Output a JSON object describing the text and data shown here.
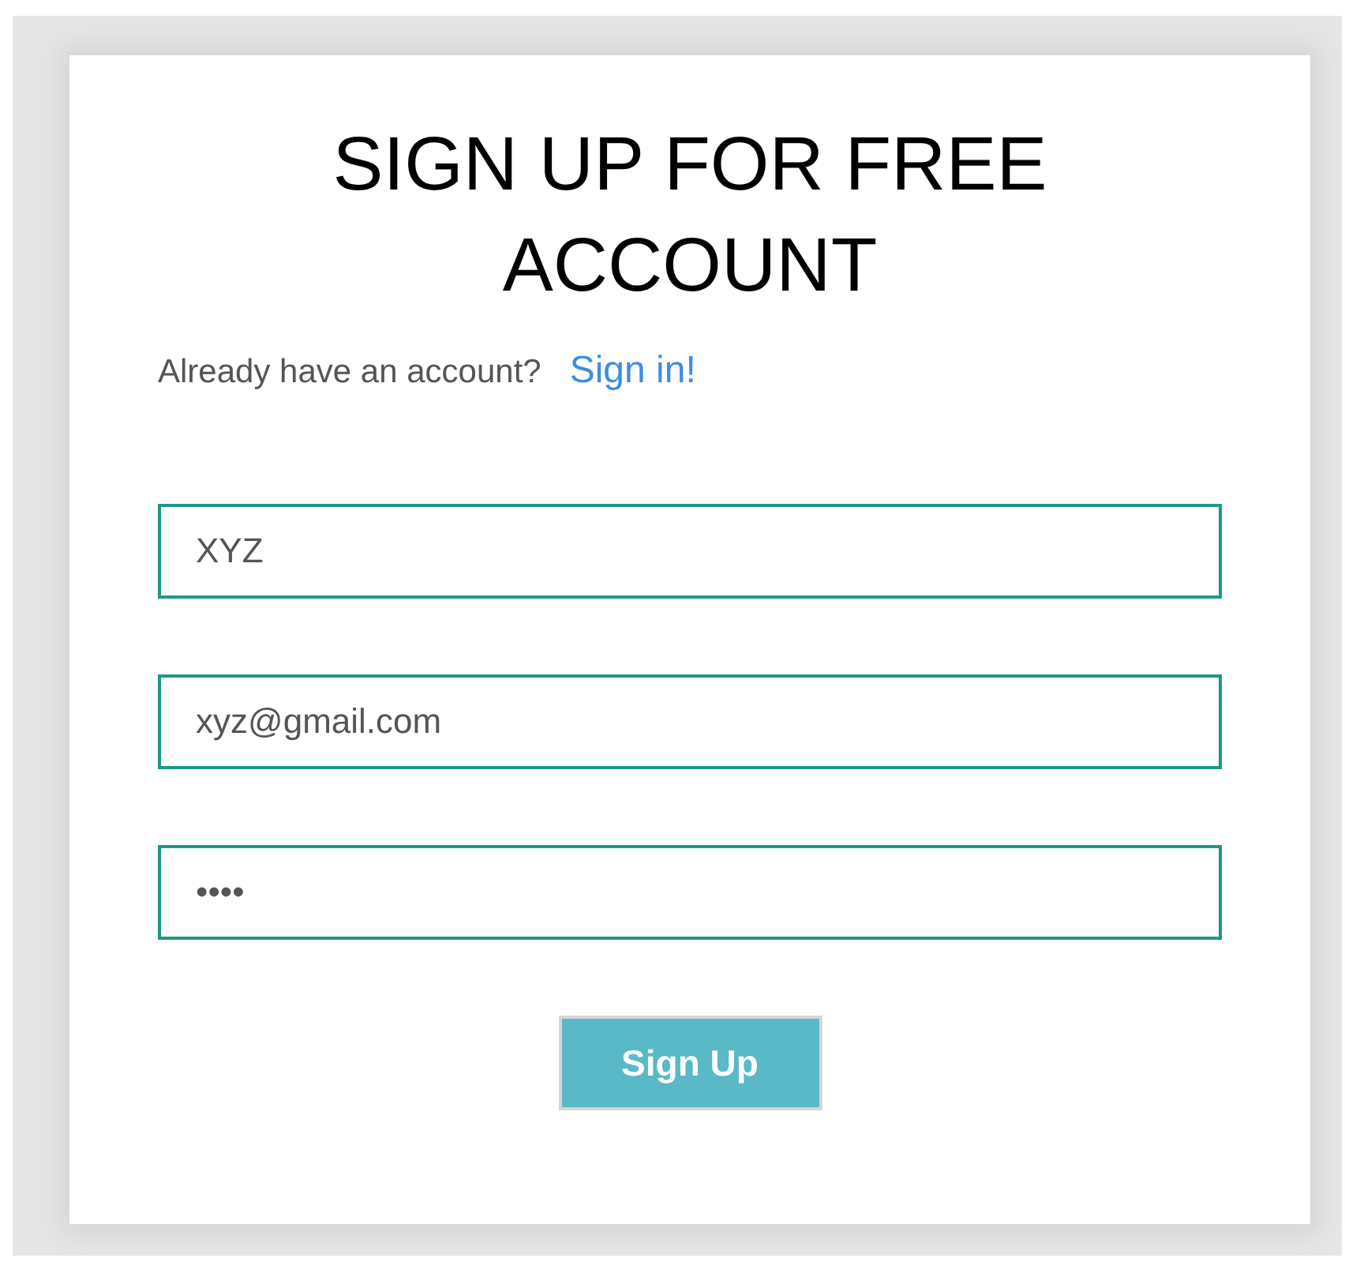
{
  "title": "SIGN UP FOR FREE ACCOUNT",
  "signin_prompt": {
    "text": "Already have an account?",
    "link": "Sign in!"
  },
  "fields": [
    {
      "value": "XYZ"
    },
    {
      "value": "xyz@gmail.com"
    },
    {
      "value": "••••"
    }
  ],
  "submit_button": "Sign Up"
}
